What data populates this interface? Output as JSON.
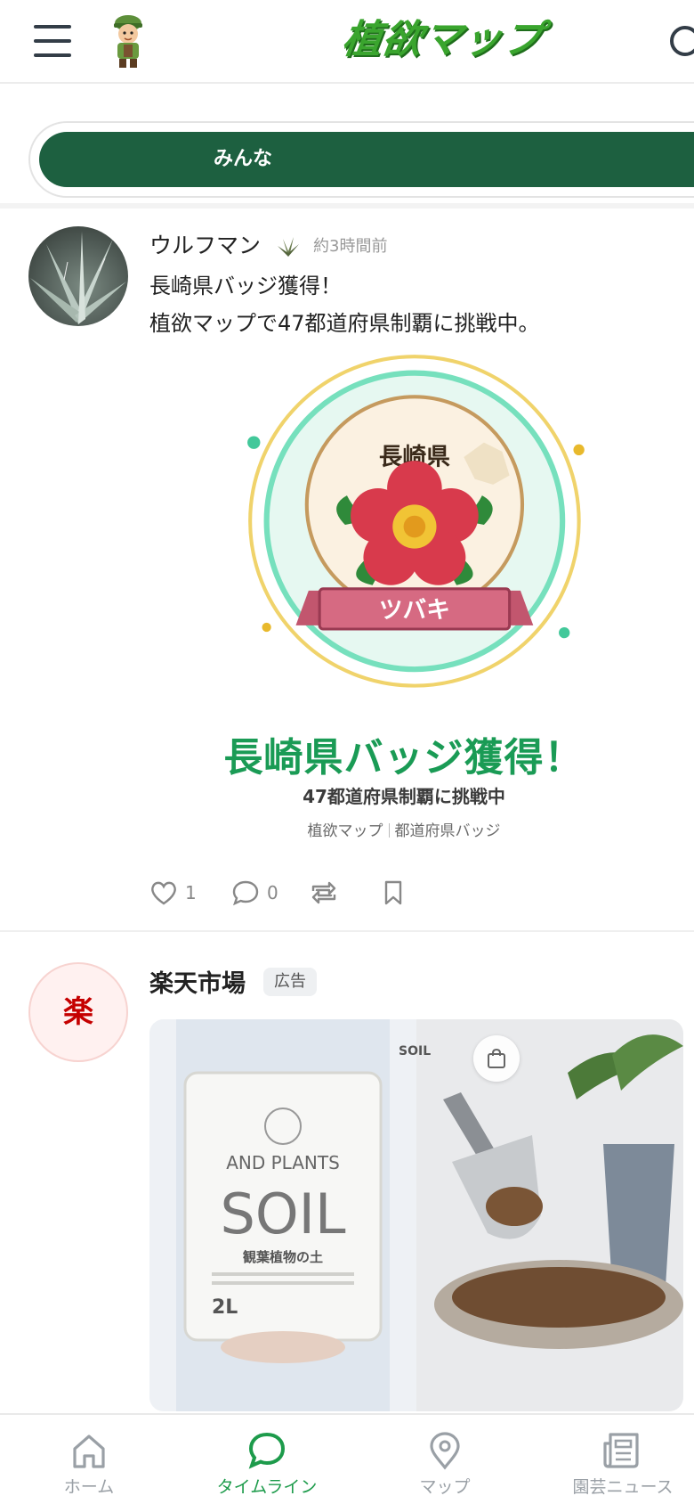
{
  "header": {
    "logo_text": "植欲マップ",
    "colors": {
      "logo": "#3aa52e",
      "text": "#333d47"
    }
  },
  "tabs": {
    "active_label": "みんな",
    "colors": {
      "active_bg": "#1d6040"
    }
  },
  "post": {
    "user_name": "ウルフマン",
    "time": "約3時間前",
    "text_lines": [
      "長崎県バッジ獲得！",
      "植欲マップで47都道府県制覇に挑戦中。"
    ],
    "badge": {
      "prefecture": "長崎県",
      "flower_label": "ツバキ",
      "title": "長崎県バッジ獲得！",
      "subtitle": "47都道府県制覇に挑戦中",
      "footer_left": "植欲マップ",
      "footer_right": "都道府県バッジ",
      "colors": {
        "title": "#1a9b55",
        "ring_outer": "#f0d36b",
        "ring_inner": "#76e0bd",
        "ribbon": "#c2566e"
      }
    },
    "actions": {
      "likes": "1",
      "comments": "0"
    }
  },
  "ad": {
    "avatar_text": "楽",
    "advertiser": "楽天市場",
    "label": "広告",
    "image": {
      "package_brand": "AND PLANTS",
      "package_title": "SOIL",
      "package_subtitle": "観葉植物の土",
      "package_size": "2L",
      "tag": "SOIL"
    }
  },
  "bottom_nav": {
    "items": [
      {
        "label": "ホーム",
        "icon": "home-icon"
      },
      {
        "label": "タイムライン",
        "icon": "chat-bubble-icon"
      },
      {
        "label": "マップ",
        "icon": "map-pin-icon"
      },
      {
        "label": "園芸ニュース",
        "icon": "newspaper-icon"
      }
    ],
    "active_color": "#1d9b4b"
  }
}
